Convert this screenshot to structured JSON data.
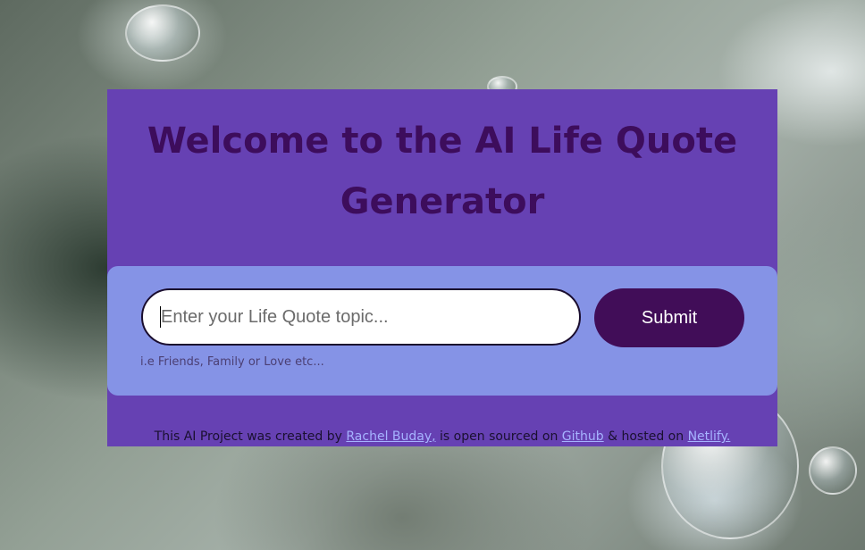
{
  "heading": {
    "line1": "Welcome to the AI Life Quote",
    "line2": "Generator"
  },
  "form": {
    "topic_placeholder": "Enter your Life Quote topic...",
    "topic_value": "",
    "submit_label": "Submit",
    "hint": "i.e Friends, Family or Love etc..."
  },
  "footer": {
    "prefix": "This AI Project was created by ",
    "author_link": "Rachel Buday,",
    "middle": " is open sourced on ",
    "github_link": "Github",
    "middle2": " & hosted on ",
    "netlify_link": "Netlify."
  },
  "colors": {
    "card_bg": "#6641b3",
    "panel_bg": "#8593e6",
    "heading": "#3d0d5c",
    "button_bg": "#410d58",
    "link": "#a6b3ff"
  },
  "icons": [
    "water-drop-background"
  ]
}
